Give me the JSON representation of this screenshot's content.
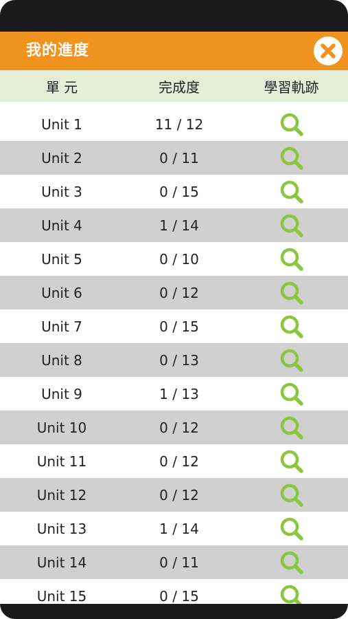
{
  "header": {
    "title": "我的進度",
    "close_icon": "close-x-icon",
    "accent": "#f0921e"
  },
  "columns": {
    "unit": "單 元",
    "progress": "完成度",
    "track": "學習軌跡"
  },
  "rows": [
    {
      "unit": "Unit 1",
      "progress": "11 / 12"
    },
    {
      "unit": "Unit 2",
      "progress": "0 / 11"
    },
    {
      "unit": "Unit 3",
      "progress": "0 / 15"
    },
    {
      "unit": "Unit 4",
      "progress": "1 / 14"
    },
    {
      "unit": "Unit 5",
      "progress": "0 / 10"
    },
    {
      "unit": "Unit 6",
      "progress": "0 / 12"
    },
    {
      "unit": "Unit 7",
      "progress": "0 / 15"
    },
    {
      "unit": "Unit 8",
      "progress": "0 / 13"
    },
    {
      "unit": "Unit 9",
      "progress": "1 / 13"
    },
    {
      "unit": "Unit 10",
      "progress": "0 / 12"
    },
    {
      "unit": "Unit 11",
      "progress": "0 / 12"
    },
    {
      "unit": "Unit 12",
      "progress": "0 / 12"
    },
    {
      "unit": "Unit 13",
      "progress": "1 / 14"
    },
    {
      "unit": "Unit 14",
      "progress": "0 / 11"
    },
    {
      "unit": "Unit 15",
      "progress": "0 / 15"
    }
  ],
  "icons": {
    "track_icon": "magnifier-search-icon",
    "icon_color": "#8cc63f"
  }
}
